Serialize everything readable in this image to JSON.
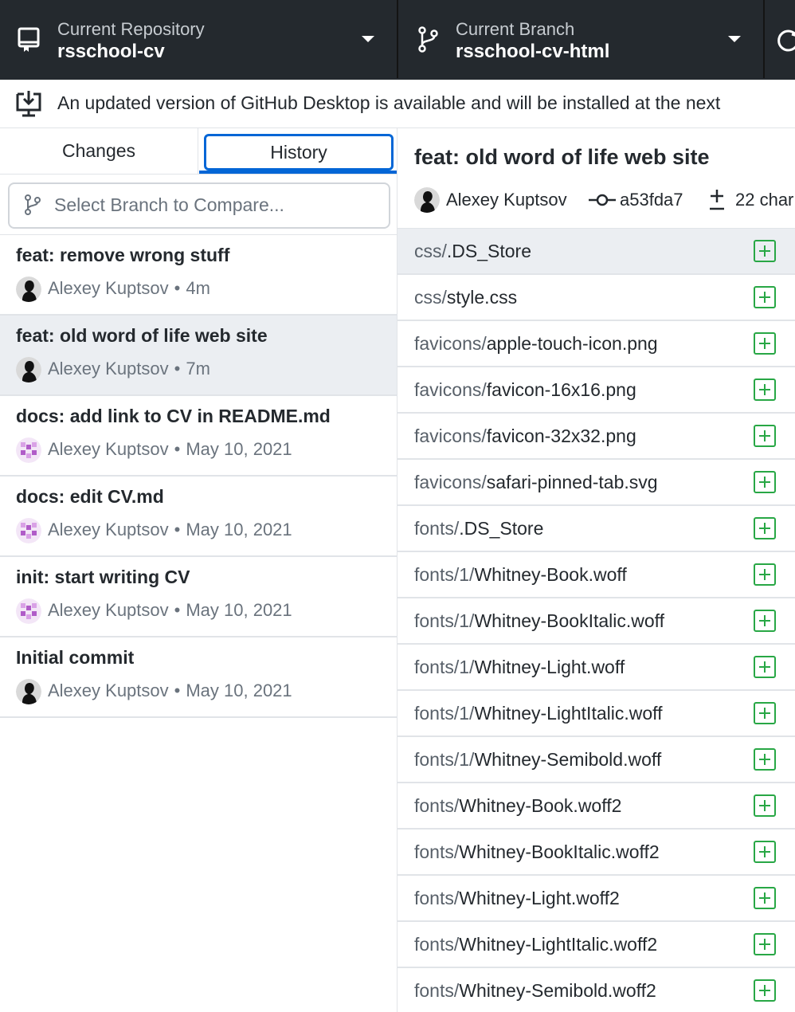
{
  "toolbar": {
    "repository": {
      "caption": "Current Repository",
      "value": "rsschool-cv",
      "icon": "repo-icon"
    },
    "branch": {
      "caption": "Current Branch",
      "value": "rsschool-cv-html",
      "icon": "branch-icon"
    },
    "fetch": {
      "icon": "sync-icon"
    }
  },
  "banner": {
    "icon": "desktop-download-icon",
    "text": "An updated version of GitHub Desktop is available and will be installed at the next"
  },
  "tabs": {
    "changes": "Changes",
    "history": "History",
    "active": "history"
  },
  "compare": {
    "placeholder": "Select Branch to Compare..."
  },
  "commits": [
    {
      "title": "feat: remove wrong stuff",
      "author": "Alexey Kuptsov",
      "time": "4m",
      "avatar": "photo",
      "selected": false
    },
    {
      "title": "feat: old word of life web site",
      "author": "Alexey Kuptsov",
      "time": "7m",
      "avatar": "photo",
      "selected": true
    },
    {
      "title": "docs: add link to CV in README.md",
      "author": "Alexey Kuptsov",
      "time": "May 10, 2021",
      "avatar": "identicon",
      "selected": false
    },
    {
      "title": "docs: edit CV.md",
      "author": "Alexey Kuptsov",
      "time": "May 10, 2021",
      "avatar": "identicon",
      "selected": false
    },
    {
      "title": "init: start writing CV",
      "author": "Alexey Kuptsov",
      "time": "May 10, 2021",
      "avatar": "identicon",
      "selected": false
    },
    {
      "title": "Initial commit",
      "author": "Alexey Kuptsov",
      "time": "May 10, 2021",
      "avatar": "photo",
      "selected": false
    }
  ],
  "detail": {
    "title": "feat: old word of life web site",
    "author": "Alexey Kuptsov",
    "sha": "a53fda7",
    "changes": "22 char"
  },
  "files": [
    {
      "dir": "css/",
      "name": ".DS_Store",
      "status": "added",
      "selected": true
    },
    {
      "dir": "css/",
      "name": "style.css",
      "status": "added",
      "selected": false
    },
    {
      "dir": "favicons/",
      "name": "apple-touch-icon.png",
      "status": "added",
      "selected": false
    },
    {
      "dir": "favicons/",
      "name": "favicon-16x16.png",
      "status": "added",
      "selected": false
    },
    {
      "dir": "favicons/",
      "name": "favicon-32x32.png",
      "status": "added",
      "selected": false
    },
    {
      "dir": "favicons/",
      "name": "safari-pinned-tab.svg",
      "status": "added",
      "selected": false
    },
    {
      "dir": "fonts/",
      "name": ".DS_Store",
      "status": "added",
      "selected": false
    },
    {
      "dir": "fonts/1/",
      "name": "Whitney-Book.woff",
      "status": "added",
      "selected": false
    },
    {
      "dir": "fonts/1/",
      "name": "Whitney-BookItalic.woff",
      "status": "added",
      "selected": false
    },
    {
      "dir": "fonts/1/",
      "name": "Whitney-Light.woff",
      "status": "added",
      "selected": false
    },
    {
      "dir": "fonts/1/",
      "name": "Whitney-LightItalic.woff",
      "status": "added",
      "selected": false
    },
    {
      "dir": "fonts/1/",
      "name": "Whitney-Semibold.woff",
      "status": "added",
      "selected": false
    },
    {
      "dir": "fonts/",
      "name": "Whitney-Book.woff2",
      "status": "added",
      "selected": false
    },
    {
      "dir": "fonts/",
      "name": "Whitney-BookItalic.woff2",
      "status": "added",
      "selected": false
    },
    {
      "dir": "fonts/",
      "name": "Whitney-Light.woff2",
      "status": "added",
      "selected": false
    },
    {
      "dir": "fonts/",
      "name": "Whitney-LightItalic.woff2",
      "status": "added",
      "selected": false
    },
    {
      "dir": "fonts/",
      "name": "Whitney-Semibold.woff2",
      "status": "added",
      "selected": false
    }
  ],
  "colors": {
    "toolbar_bg": "#24292e",
    "accent": "#0366d6",
    "added": "#28a745",
    "selected_bg": "#ebeef2"
  }
}
